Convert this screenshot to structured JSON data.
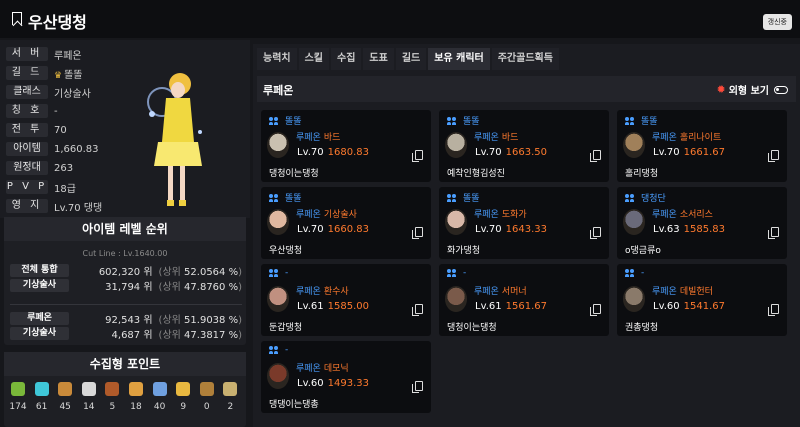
{
  "header": {
    "title": "우산댕청",
    "refresh_label": "갱신중"
  },
  "profile": {
    "rows": [
      {
        "label": "서 버",
        "value": "루페온"
      },
      {
        "label": "길 드",
        "value": "똘똘",
        "crown": true
      },
      {
        "label": "클래스",
        "value": "기상술사"
      },
      {
        "label": "칭 호",
        "value": "-"
      },
      {
        "label": "전 투",
        "value": "70"
      },
      {
        "label": "아이템",
        "value": "1,660.83"
      },
      {
        "label": "원정대",
        "value": "263"
      },
      {
        "label": "P V P",
        "value": "18급"
      },
      {
        "label": "영 지",
        "value": "Lv.70 댕댕"
      }
    ]
  },
  "ranking": {
    "title": "아이템 레벨 순위",
    "cutline": "Cut Line : Lv.1640.00",
    "rows": [
      {
        "label": "전체 통합",
        "rank": "602,320 위",
        "pct": "52.0564 %"
      },
      {
        "label": "기상술사",
        "rank": "31,794 위",
        "pct": "47.8760 %"
      },
      {
        "label": "루페온",
        "rank": "92,543 위",
        "pct": "51.9038 %"
      },
      {
        "label": "기상술사",
        "rank": "4,687 위",
        "pct": "47.3817 %"
      }
    ],
    "pct_prefix": "(상위",
    "pct_suffix": ")"
  },
  "collection": {
    "title": "수집형 포인트",
    "items": [
      {
        "icon": "mokoko-seed-icon",
        "value": "174",
        "color": "#7ab83a"
      },
      {
        "icon": "island-heart-icon",
        "value": "61",
        "color": "#3fc7d8"
      },
      {
        "icon": "great-art-icon",
        "value": "45",
        "color": "#c98a3a"
      },
      {
        "icon": "giant-heart-icon",
        "value": "14",
        "color": "#d8d8d8"
      },
      {
        "icon": "ignea-token-icon",
        "value": "5",
        "color": "#b05a2a"
      },
      {
        "icon": "adventure-icon",
        "value": "18",
        "color": "#e0a040"
      },
      {
        "icon": "world-tree-leaf-icon",
        "value": "40",
        "color": "#6fa0e0"
      },
      {
        "icon": "orpheus-star-icon",
        "value": "9",
        "color": "#e8b840"
      },
      {
        "icon": "omnium-star-icon",
        "value": "0",
        "color": "#b0803a"
      },
      {
        "icon": "music-box-icon",
        "value": "2",
        "color": "#c8b070"
      }
    ]
  },
  "tabs": [
    "능력치",
    "스킬",
    "수집",
    "도표",
    "길드",
    "보유 캐릭터",
    "주간골드획득"
  ],
  "active_tab": "보유 캐릭터",
  "section": {
    "title": "루페온",
    "look_label": "외형 보기"
  },
  "characters": [
    {
      "guild": "똘똘",
      "server": "루페온",
      "cls": "바드",
      "lv": "Lv.70",
      "ilvl": "1680.83",
      "name": "댕청이는댕청",
      "tone": "#c9c0b0"
    },
    {
      "guild": "똘똘",
      "server": "루페온",
      "cls": "바드",
      "lv": "Lv.70",
      "ilvl": "1663.50",
      "name": "예착인형김성진",
      "tone": "#b8b0a0"
    },
    {
      "guild": "똘똘",
      "server": "루페온",
      "cls": "홀리나이트",
      "lv": "Lv.70",
      "ilvl": "1661.67",
      "name": "홀리댕청",
      "tone": "#a0805a"
    },
    {
      "guild": "똘똘",
      "server": "루페온",
      "cls": "기상술사",
      "lv": "Lv.70",
      "ilvl": "1660.83",
      "name": "우산댕청",
      "tone": "#e0b8a0"
    },
    {
      "guild": "똘똘",
      "server": "루페온",
      "cls": "도화가",
      "lv": "Lv.70",
      "ilvl": "1643.33",
      "name": "화가댕청",
      "tone": "#d8b8a8"
    },
    {
      "guild": "댕청단",
      "server": "루페온",
      "cls": "소서리스",
      "lv": "Lv.63",
      "ilvl": "1585.83",
      "name": "o댕금류o",
      "tone": "#6a6a7a"
    },
    {
      "guild": "-",
      "server": "루페온",
      "cls": "환수사",
      "lv": "Lv.61",
      "ilvl": "1585.00",
      "name": "둔갑댕청",
      "tone": "#c09080"
    },
    {
      "guild": "-",
      "server": "루페온",
      "cls": "서머너",
      "lv": "Lv.61",
      "ilvl": "1561.67",
      "name": "댕청이는댕청",
      "tone": "#7a5a4a"
    },
    {
      "guild": "-",
      "server": "루페온",
      "cls": "데빌헌터",
      "lv": "Lv.60",
      "ilvl": "1541.67",
      "name": "권총댕청",
      "tone": "#8a7a6a"
    },
    {
      "guild": "-",
      "server": "루페온",
      "cls": "데모닉",
      "lv": "Lv.60",
      "ilvl": "1493.33",
      "name": "댕댕이는댕총",
      "tone": "#7a3a2a"
    }
  ]
}
